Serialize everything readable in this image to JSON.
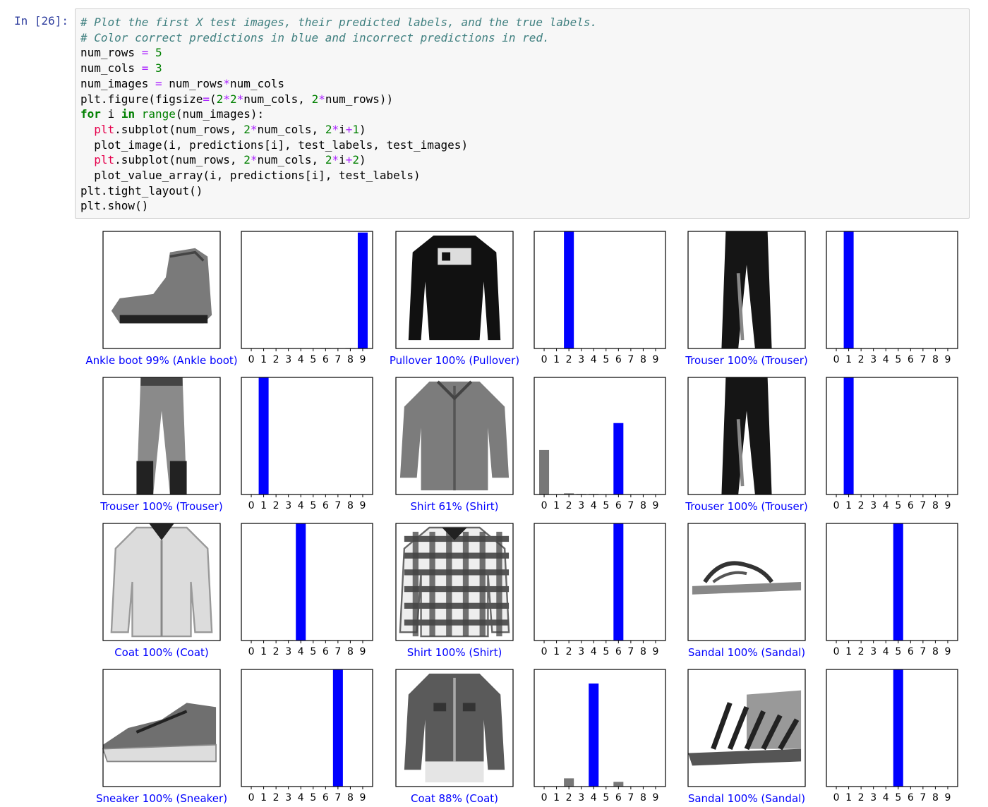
{
  "prompt": "In [26]:",
  "code": {
    "lines": [
      [
        {
          "t": "# Plot the first X test images, their predicted labels, and the true labels.",
          "c": "comment"
        }
      ],
      [
        {
          "t": "# Color correct predictions in blue and incorrect predictions in red.",
          "c": "comment"
        }
      ],
      [
        {
          "t": "num_rows "
        },
        {
          "t": "=",
          "c": "op"
        },
        {
          "t": " "
        },
        {
          "t": "5",
          "c": "num"
        }
      ],
      [
        {
          "t": "num_cols "
        },
        {
          "t": "=",
          "c": "op"
        },
        {
          "t": " "
        },
        {
          "t": "3",
          "c": "num"
        }
      ],
      [
        {
          "t": "num_images "
        },
        {
          "t": "=",
          "c": "op"
        },
        {
          "t": " num_rows"
        },
        {
          "t": "*",
          "c": "op"
        },
        {
          "t": "num_cols"
        }
      ],
      [
        {
          "t": "plt.figure(figsize"
        },
        {
          "t": "=",
          "c": "op"
        },
        {
          "t": "("
        },
        {
          "t": "2",
          "c": "num"
        },
        {
          "t": "*",
          "c": "op"
        },
        {
          "t": "2",
          "c": "num"
        },
        {
          "t": "*",
          "c": "op"
        },
        {
          "t": "num_cols, "
        },
        {
          "t": "2",
          "c": "num"
        },
        {
          "t": "*",
          "c": "op"
        },
        {
          "t": "num_rows))"
        }
      ],
      [
        {
          "t": "for",
          "c": "kw"
        },
        {
          "t": " i "
        },
        {
          "t": "in",
          "c": "kw"
        },
        {
          "t": " "
        },
        {
          "t": "range",
          "c": "builtin"
        },
        {
          "t": "(num_images):"
        }
      ],
      [
        {
          "t": "  "
        },
        {
          "t": "plt",
          "c": "plt"
        },
        {
          "t": ".subplot(num_rows, "
        },
        {
          "t": "2",
          "c": "num"
        },
        {
          "t": "*",
          "c": "op"
        },
        {
          "t": "num_cols, "
        },
        {
          "t": "2",
          "c": "num"
        },
        {
          "t": "*",
          "c": "op"
        },
        {
          "t": "i"
        },
        {
          "t": "+",
          "c": "op"
        },
        {
          "t": "1",
          "c": "num"
        },
        {
          "t": ")"
        }
      ],
      [
        {
          "t": "  plot_image(i, predictions[i], test_labels, test_images)"
        }
      ],
      [
        {
          "t": "  "
        },
        {
          "t": "plt",
          "c": "plt"
        },
        {
          "t": ".subplot(num_rows, "
        },
        {
          "t": "2",
          "c": "num"
        },
        {
          "t": "*",
          "c": "op"
        },
        {
          "t": "num_cols, "
        },
        {
          "t": "2",
          "c": "num"
        },
        {
          "t": "*",
          "c": "op"
        },
        {
          "t": "i"
        },
        {
          "t": "+",
          "c": "op"
        },
        {
          "t": "2",
          "c": "num"
        },
        {
          "t": ")"
        }
      ],
      [
        {
          "t": "  plot_value_array(i, predictions[i], test_labels)"
        }
      ],
      [
        {
          "t": "plt.tight_layout()"
        }
      ],
      [
        {
          "t": "plt.show()"
        }
      ]
    ]
  },
  "colors": {
    "correct": "#0000ff",
    "bar_default": "#777777",
    "label_text": "#0000ff"
  },
  "chart_data": {
    "type": "bar",
    "categories": [
      "0",
      "1",
      "2",
      "3",
      "4",
      "5",
      "6",
      "7",
      "8",
      "9"
    ],
    "ylim": [
      0,
      1
    ],
    "grid": false,
    "panels": [
      {
        "image": "ankle-boot",
        "caption": "Ankle boot 99% (Ankle boot)",
        "predicted": 9,
        "values": [
          0,
          0,
          0,
          0,
          0,
          0,
          0.004,
          0,
          0.004,
          0.99
        ]
      },
      {
        "image": "pullover",
        "caption": "Pullover 100% (Pullover)",
        "predicted": 2,
        "values": [
          0,
          0,
          1,
          0,
          0,
          0,
          0,
          0,
          0,
          0
        ]
      },
      {
        "image": "trouser",
        "caption": "Trouser 100% (Trouser)",
        "predicted": 1,
        "values": [
          0,
          1,
          0,
          0,
          0,
          0,
          0,
          0,
          0,
          0
        ]
      },
      {
        "image": "trouser-light",
        "caption": "Trouser 100% (Trouser)",
        "predicted": 1,
        "values": [
          0,
          1,
          0,
          0,
          0,
          0,
          0,
          0,
          0,
          0
        ]
      },
      {
        "image": "shirt",
        "caption": "Shirt 61% (Shirt)",
        "predicted": 6,
        "values": [
          0.38,
          0,
          0.01,
          0.005,
          0.005,
          0,
          0.61,
          0,
          0,
          0
        ]
      },
      {
        "image": "trouser",
        "caption": "Trouser 100% (Trouser)",
        "predicted": 1,
        "values": [
          0,
          1,
          0,
          0,
          0,
          0,
          0,
          0,
          0,
          0
        ]
      },
      {
        "image": "coat",
        "caption": "Coat 100% (Coat)",
        "predicted": 4,
        "values": [
          0,
          0,
          0,
          0.004,
          1,
          0,
          0.004,
          0,
          0,
          0
        ]
      },
      {
        "image": "plaid-shirt",
        "caption": "Shirt 100% (Shirt)",
        "predicted": 6,
        "values": [
          0,
          0,
          0,
          0,
          0,
          0.004,
          1,
          0,
          0,
          0
        ]
      },
      {
        "image": "sandal-flat",
        "caption": "Sandal 100% (Sandal)",
        "predicted": 5,
        "values": [
          0,
          0,
          0,
          0,
          0,
          1,
          0,
          0,
          0,
          0
        ]
      },
      {
        "image": "sneaker",
        "caption": "Sneaker 100% (Sneaker)",
        "predicted": 7,
        "values": [
          0,
          0,
          0,
          0,
          0,
          0,
          0,
          1,
          0,
          0
        ]
      },
      {
        "image": "coat-jacket",
        "caption": "Coat 88% (Coat)",
        "predicted": 4,
        "values": [
          0,
          0,
          0.07,
          0,
          0.88,
          0,
          0.04,
          0,
          0,
          0
        ]
      },
      {
        "image": "sandal-strappy",
        "caption": "Sandal 100% (Sandal)",
        "predicted": 5,
        "values": [
          0,
          0,
          0,
          0,
          0,
          1,
          0,
          0,
          0,
          0
        ]
      }
    ]
  }
}
